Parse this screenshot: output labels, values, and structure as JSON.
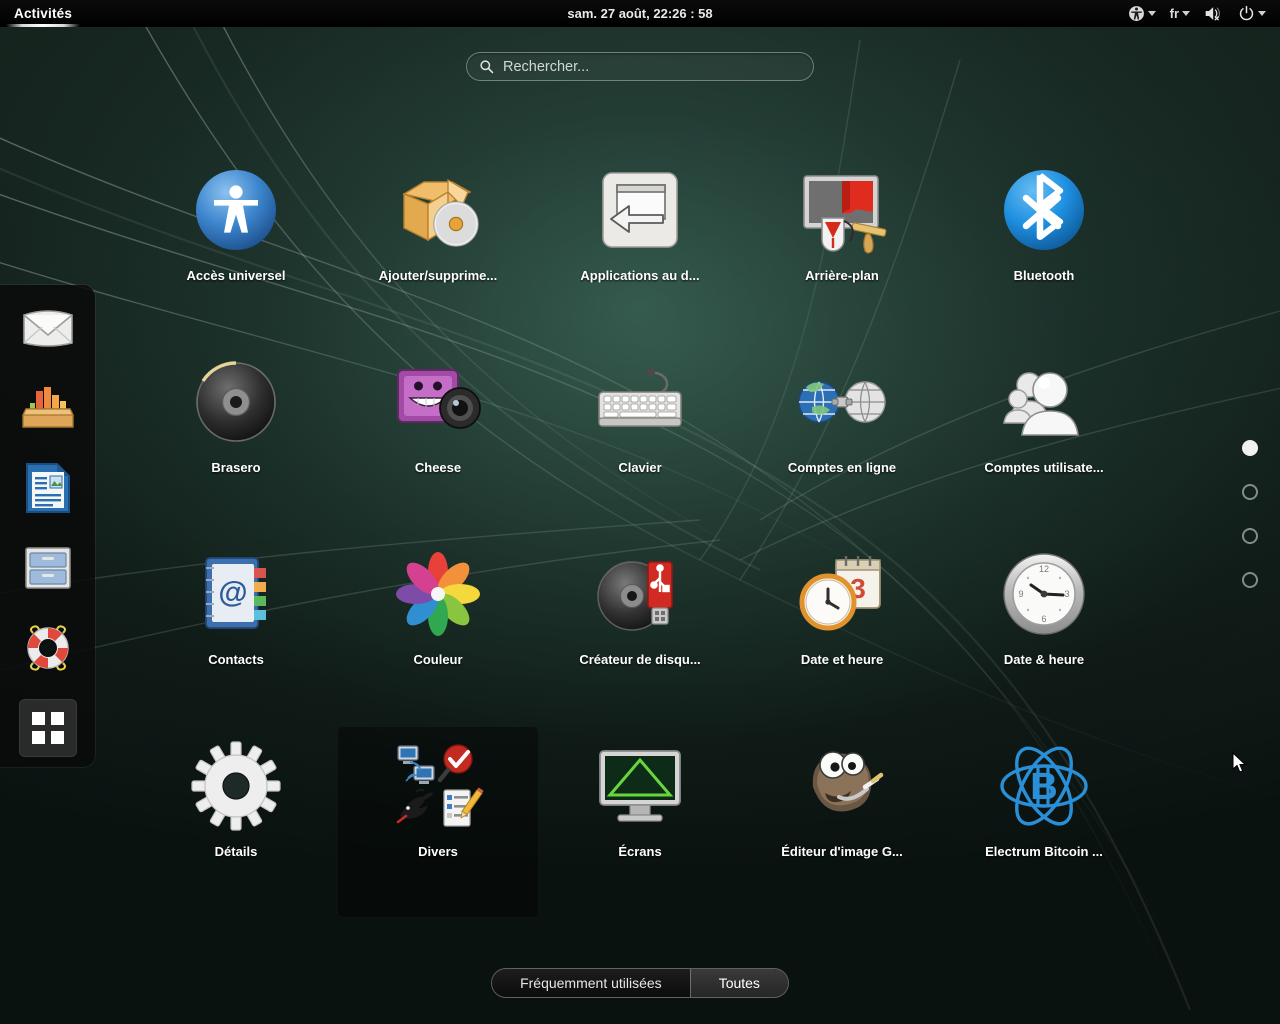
{
  "topbar": {
    "activities_label": "Activités",
    "clock": "sam. 27 août, 22:26 : 58",
    "accessibility_icon": "accessibility-icon",
    "keyboard_layout": "fr",
    "volume_icon": "volume-muted-icon",
    "power_icon": "power-icon"
  },
  "search": {
    "placeholder": "Rechercher...",
    "value": "",
    "icon": "search-icon"
  },
  "apps": [
    {
      "label": "Accès universel",
      "icon": "universal-access-icon"
    },
    {
      "label": "Ajouter/supprime...",
      "icon": "add-remove-software-icon"
    },
    {
      "label": "Applications au d...",
      "icon": "startup-applications-icon"
    },
    {
      "label": "Arrière-plan",
      "icon": "background-wallpaper-icon"
    },
    {
      "label": "Bluetooth",
      "icon": "bluetooth-icon"
    },
    {
      "label": "Brasero",
      "icon": "brasero-disc-icon"
    },
    {
      "label": "Cheese",
      "icon": "cheese-webcam-icon"
    },
    {
      "label": "Clavier",
      "icon": "keyboard-icon"
    },
    {
      "label": "Comptes en ligne",
      "icon": "online-accounts-icon"
    },
    {
      "label": "Comptes utilisate...",
      "icon": "user-accounts-icon"
    },
    {
      "label": "Contacts",
      "icon": "contacts-address-book-icon"
    },
    {
      "label": "Couleur",
      "icon": "color-flower-icon"
    },
    {
      "label": "Créateur de disqu...",
      "icon": "usb-disk-creator-icon"
    },
    {
      "label": "Date et heure",
      "icon": "date-time-calendar-icon"
    },
    {
      "label": "Date & heure",
      "icon": "analog-clock-icon"
    },
    {
      "label": "Détails",
      "icon": "details-gear-icon"
    },
    {
      "label": "Divers",
      "icon": "folder-misc-icon",
      "folder": true
    },
    {
      "label": "Écrans",
      "icon": "displays-monitor-icon"
    },
    {
      "label": "Éditeur d'image G...",
      "icon": "gimp-icon"
    },
    {
      "label": "Electrum Bitcoin ...",
      "icon": "electrum-bitcoin-icon"
    }
  ],
  "dock": [
    {
      "name": "evolution-mail-icon"
    },
    {
      "name": "software-center-icon"
    },
    {
      "name": "libreoffice-writer-icon"
    },
    {
      "name": "files-nautilus-icon"
    },
    {
      "name": "help-lifebuoy-icon"
    },
    {
      "name": "show-applications-icon",
      "active": true
    }
  ],
  "pages": {
    "count": 4,
    "active": 0
  },
  "switcher": {
    "frequent_label": "Fréquemment utilisées",
    "all_label": "Toutes",
    "active": "Toutes"
  },
  "colors": {
    "accent_blue": "#2d7fd4",
    "bluetooth_blue": "#1f8fe0",
    "electrum_blue": "#2a8fd6",
    "wallpaper_green": "#1c302a",
    "topbar_black": "#070707"
  }
}
